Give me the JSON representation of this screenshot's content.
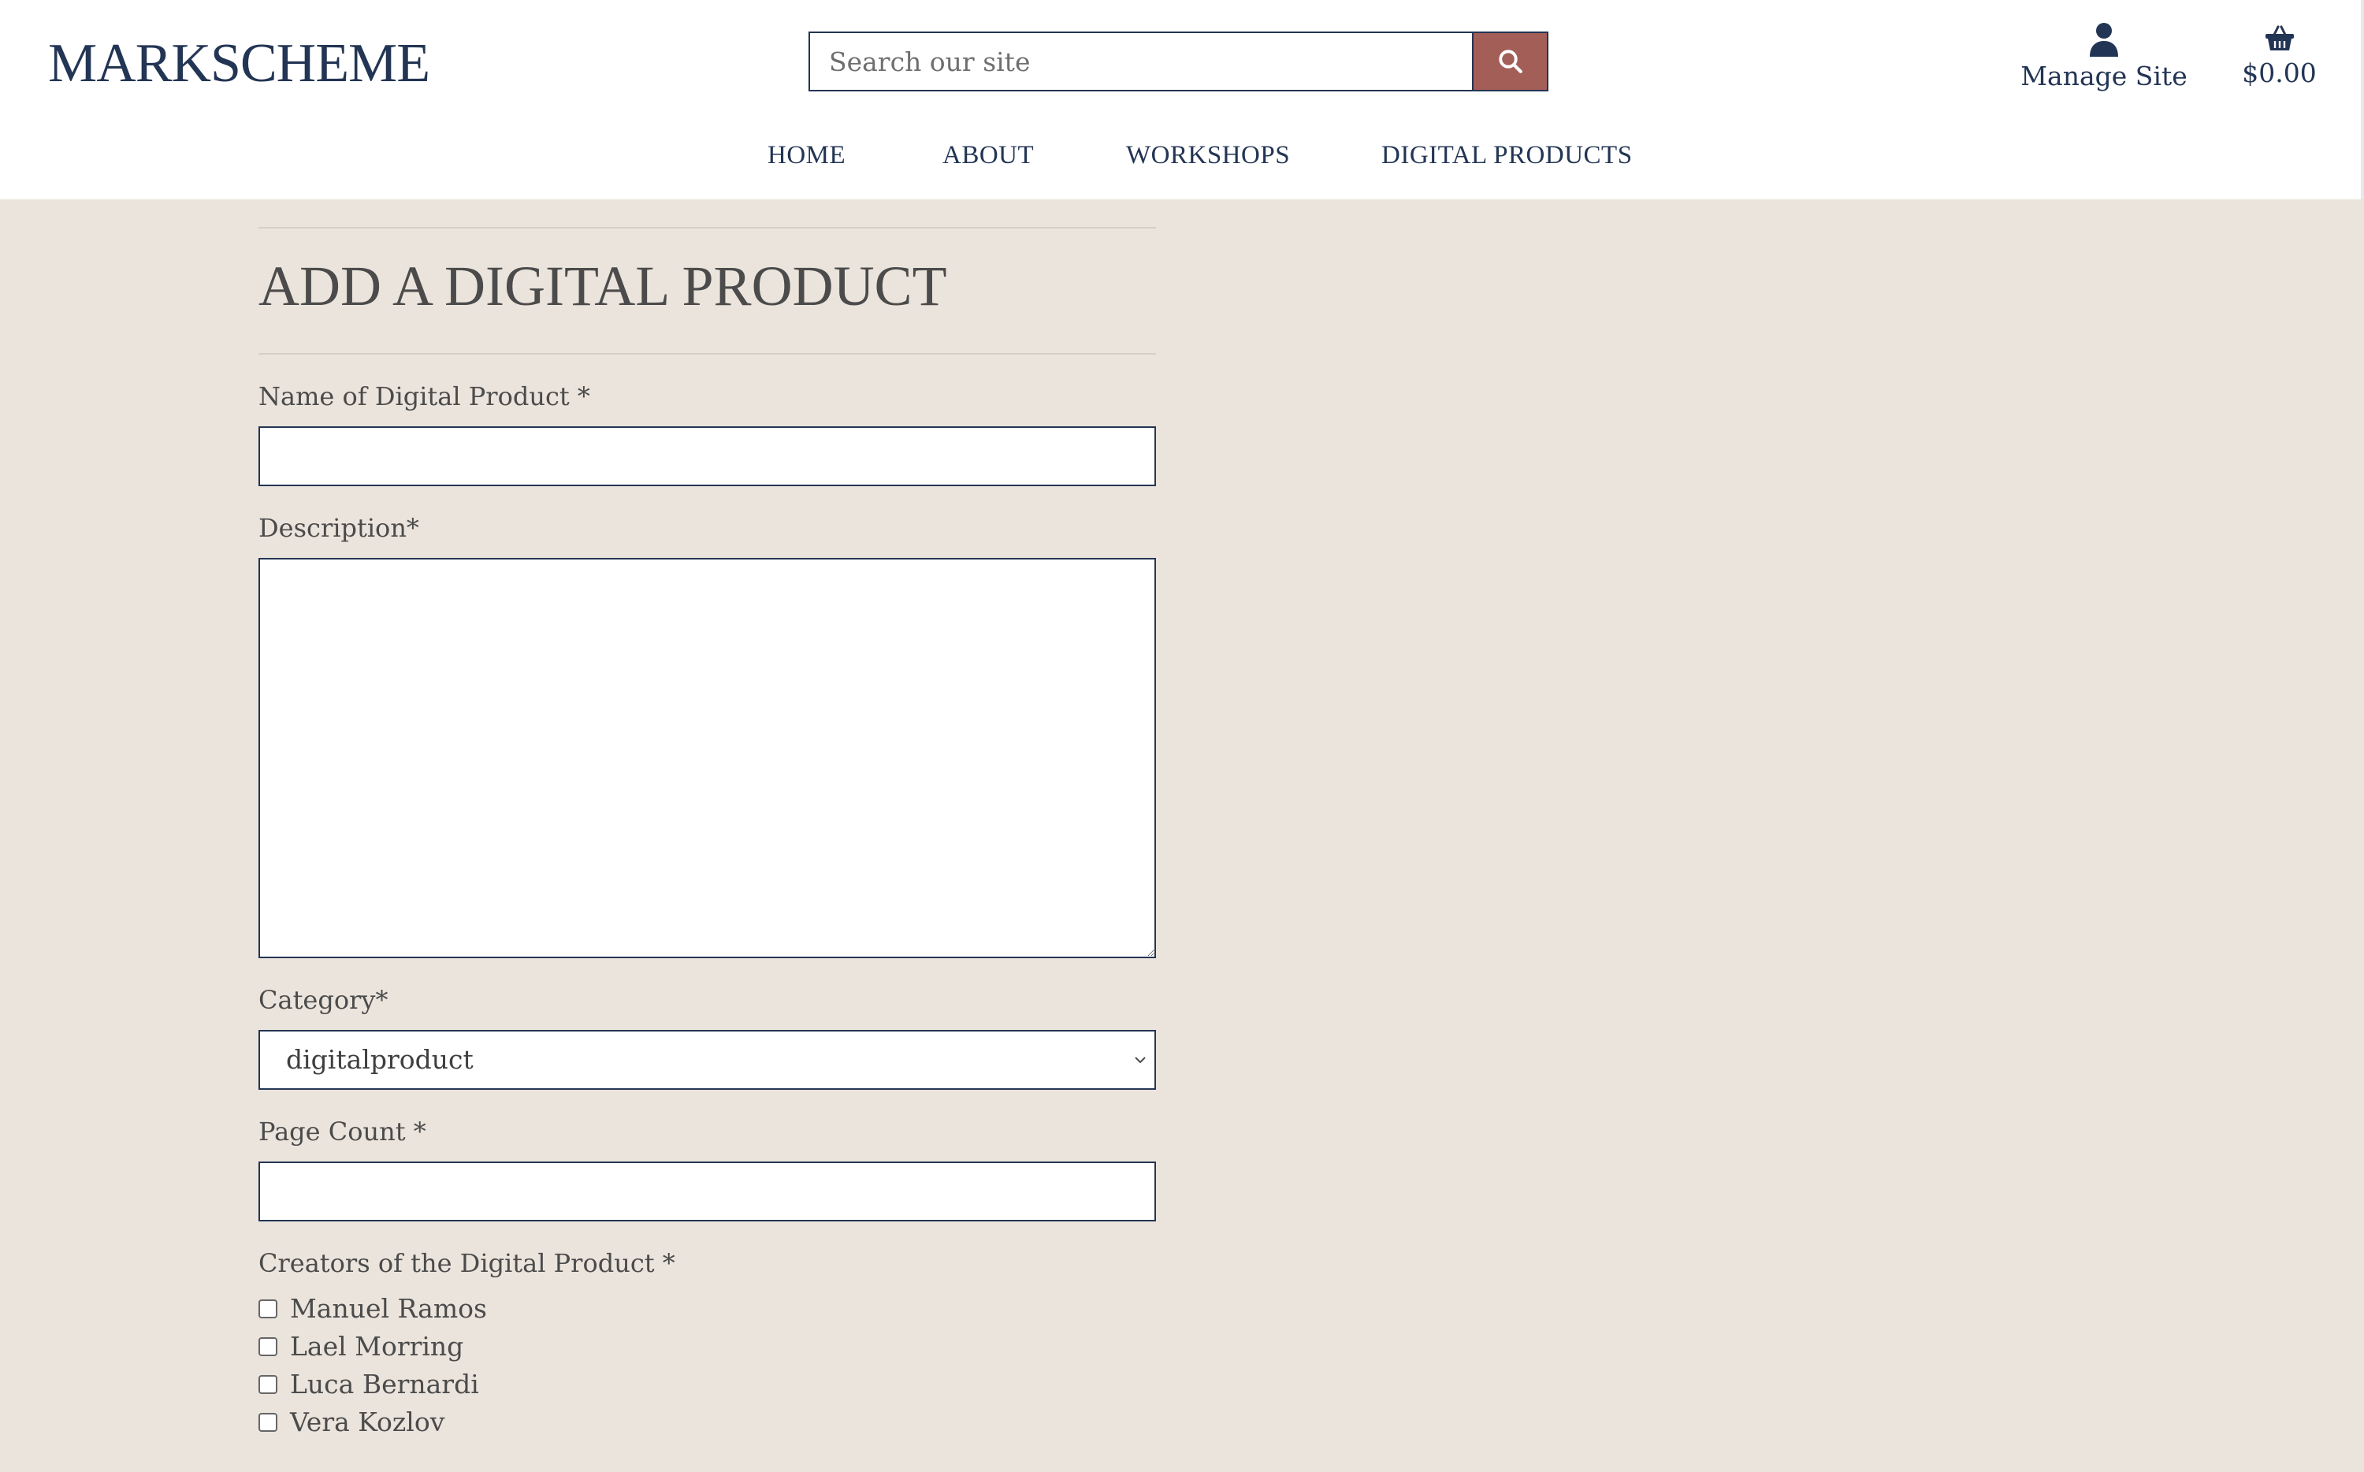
{
  "header": {
    "logo": "MARKSCHEME",
    "search": {
      "placeholder": "Search our site",
      "value": ""
    },
    "account_label": "Manage Site",
    "basket_total": "$0.00",
    "icons": {
      "search": "search-icon",
      "account": "user-icon",
      "basket": "basket-icon"
    },
    "colors": {
      "brand": "#233554",
      "search_button": "#a35e58"
    }
  },
  "nav": {
    "items": [
      {
        "label": "HOME"
      },
      {
        "label": "ABOUT"
      },
      {
        "label": "WORKSHOPS"
      },
      {
        "label": "DIGITAL PRODUCTS"
      }
    ]
  },
  "form": {
    "title": "ADD A DIGITAL PRODUCT",
    "name_label": "Name of Digital Product *",
    "name_value": "",
    "description_label": "Description*",
    "description_value": "",
    "category_label": "Category*",
    "category_selected": "digitalproduct",
    "page_count_label": "Page Count *",
    "page_count_value": "",
    "creators_label": "Creators of the Digital Product *",
    "creators": [
      {
        "name": "Manuel Ramos",
        "checked": false
      },
      {
        "name": "Lael Morring",
        "checked": false
      },
      {
        "name": "Luca Bernardi",
        "checked": false
      },
      {
        "name": "Vera Kozlov",
        "checked": false
      }
    ]
  },
  "colors": {
    "page_background": "#ebe4dc"
  }
}
